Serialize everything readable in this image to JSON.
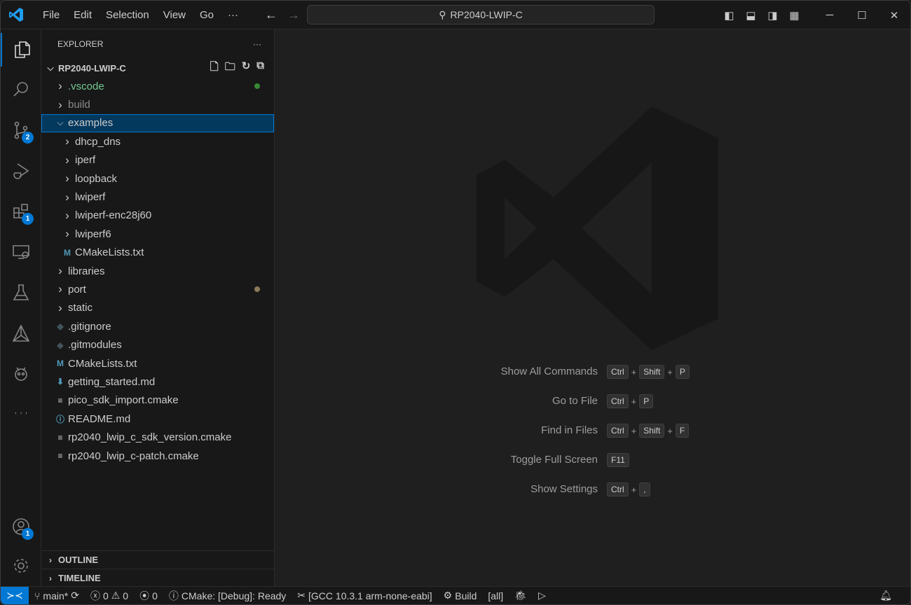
{
  "menu": [
    "File",
    "Edit",
    "Selection",
    "View",
    "Go",
    "···"
  ],
  "search_title": "RP2040-LWIP-C",
  "activity_badges": {
    "scm": "2",
    "extensions": "1",
    "accounts": "1"
  },
  "explorer": {
    "title": "EXPLORER",
    "more": "···",
    "root": "RP2040-LWIP-C",
    "items": [
      {
        "label": ".vscode",
        "type": "folder",
        "level": 1,
        "color": "#73c991",
        "dot": "#388a34"
      },
      {
        "label": "build",
        "type": "folder",
        "level": 1,
        "color": "#8c8c8c"
      },
      {
        "label": "examples",
        "type": "folder-open",
        "level": 1,
        "selected": true
      },
      {
        "label": "dhcp_dns",
        "type": "folder",
        "level": 2
      },
      {
        "label": "iperf",
        "type": "folder",
        "level": 2
      },
      {
        "label": "loopback",
        "type": "folder",
        "level": 2
      },
      {
        "label": "lwiperf",
        "type": "folder",
        "level": 2
      },
      {
        "label": "lwiperf-enc28j60",
        "type": "folder",
        "level": 2
      },
      {
        "label": "lwiperf6",
        "type": "folder",
        "level": 2
      },
      {
        "label": "CMakeLists.txt",
        "type": "file",
        "level": 2,
        "icon": "M",
        "iconColor": "#519aba"
      },
      {
        "label": "libraries",
        "type": "folder",
        "level": 1
      },
      {
        "label": "port",
        "type": "folder",
        "level": 1,
        "dot": "#8a7a5a"
      },
      {
        "label": "static",
        "type": "folder",
        "level": 1
      },
      {
        "label": ".gitignore",
        "type": "file",
        "level": 1,
        "icon": "◆",
        "iconColor": "#41535b"
      },
      {
        "label": ".gitmodules",
        "type": "file",
        "level": 1,
        "icon": "◆",
        "iconColor": "#41535b"
      },
      {
        "label": "CMakeLists.txt",
        "type": "file",
        "level": 1,
        "icon": "M",
        "iconColor": "#519aba"
      },
      {
        "label": "getting_started.md",
        "type": "file",
        "level": 1,
        "icon": "⬇",
        "iconColor": "#519aba"
      },
      {
        "label": "pico_sdk_import.cmake",
        "type": "file",
        "level": 1,
        "icon": "≡",
        "iconColor": "#ccc"
      },
      {
        "label": "README.md",
        "type": "file",
        "level": 1,
        "icon": "ⓘ",
        "iconColor": "#519aba"
      },
      {
        "label": "rp2040_lwip_c_sdk_version.cmake",
        "type": "file",
        "level": 1,
        "icon": "≡",
        "iconColor": "#ccc"
      },
      {
        "label": "rp2040_lwip_c-patch.cmake",
        "type": "file",
        "level": 1,
        "icon": "≡",
        "iconColor": "#ccc"
      }
    ],
    "outline": "OUTLINE",
    "timeline": "TIMELINE"
  },
  "shortcuts": [
    {
      "label": "Show All Commands",
      "keys": [
        "Ctrl",
        "Shift",
        "P"
      ]
    },
    {
      "label": "Go to File",
      "keys": [
        "Ctrl",
        "P"
      ]
    },
    {
      "label": "Find in Files",
      "keys": [
        "Ctrl",
        "Shift",
        "F"
      ]
    },
    {
      "label": "Toggle Full Screen",
      "keys": [
        "F11"
      ]
    },
    {
      "label": "Show Settings",
      "keys": [
        "Ctrl",
        ","
      ]
    }
  ],
  "status": {
    "branch": "main*",
    "errors": "0",
    "warnings": "0",
    "ports": "0",
    "cmake": "CMake: [Debug]: Ready",
    "kit": "[GCC 10.3.1 arm-none-eabi]",
    "build": "Build",
    "target": "[all]"
  },
  "colors": {
    "accent": "#0078d4",
    "selection": "#04395e"
  }
}
